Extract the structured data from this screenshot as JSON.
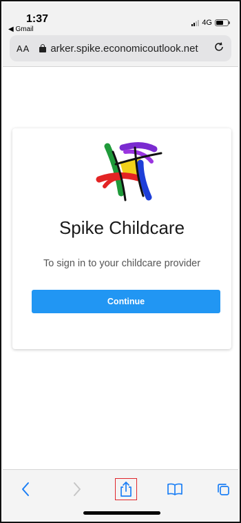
{
  "status_bar": {
    "time": "1:37",
    "back_app": "◀ Gmail",
    "network": "4G"
  },
  "address_bar": {
    "text_size_label": "AA",
    "url": "arker.spike.economicoutlook.net"
  },
  "card": {
    "title": "Spike Childcare",
    "subtitle": "To sign in to your childcare provider",
    "continue_label": "Continue"
  },
  "colors": {
    "accent": "#2196f3",
    "toolbar_icon": "#1a7ef5",
    "highlight_box": "#e0252b"
  },
  "toolbar": {
    "icons": [
      "chevron-left-icon",
      "chevron-right-icon",
      "share-icon",
      "bookmarks-icon",
      "tabs-icon"
    ]
  }
}
